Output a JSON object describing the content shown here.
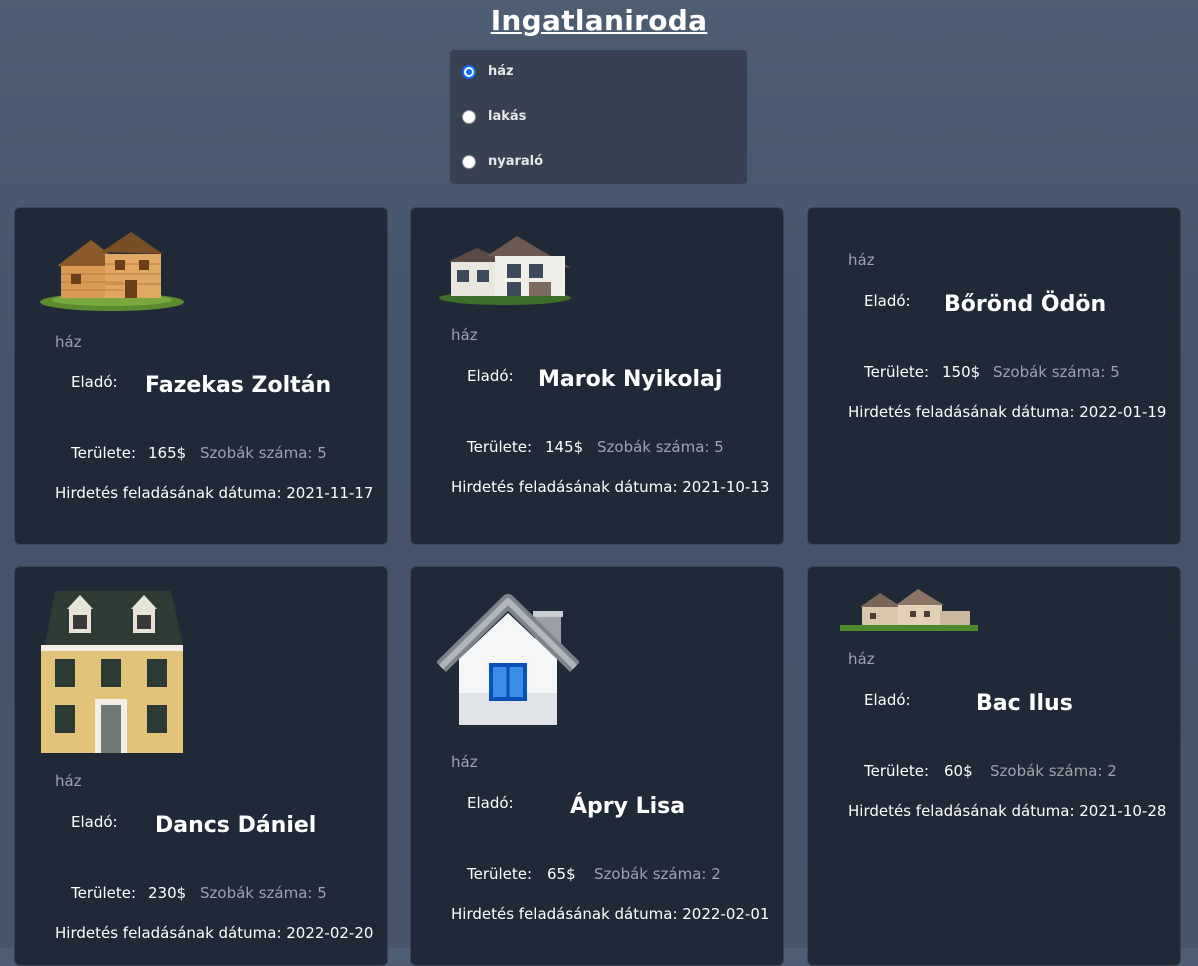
{
  "page": {
    "title": "Ingatlaniroda"
  },
  "filter": {
    "options": [
      {
        "label": "ház",
        "checked": true
      },
      {
        "label": "lakás",
        "checked": false
      },
      {
        "label": "nyaraló",
        "checked": false
      }
    ]
  },
  "labels": {
    "seller": "Eladó:",
    "area": "Területe:",
    "rooms_prefix": "Szobák száma:",
    "date_prefix": "Hirdetés feladásának dátuma:"
  },
  "listings": [
    {
      "type": "ház",
      "seller": "Fazekas Zoltán",
      "area": "165$",
      "rooms": "Szobák száma: 5",
      "date": "Hirdetés feladásának dátuma: 2021-11-17",
      "image": "log-cabin-house-image"
    },
    {
      "type": "ház",
      "seller": "Marok Nyikolaj",
      "area": "145$",
      "rooms": "Szobák száma: 5",
      "date": "Hirdetés feladásának dátuma: 2021-10-13",
      "image": "modern-house-image"
    },
    {
      "type": "ház",
      "seller": "Bőrönd Ödön",
      "area": "150$",
      "rooms": "Szobák száma: 5",
      "date": "Hirdetés feladásának dátuma: 2022-01-19",
      "image": null
    },
    {
      "type": "ház",
      "seller": "Dancs Dániel",
      "area": "230$",
      "rooms": "Szobák száma: 5",
      "date": "Hirdetés feladásának dátuma: 2022-02-20",
      "image": "dollhouse-image"
    },
    {
      "type": "ház",
      "seller": "Ápry Lisa",
      "area": "65$",
      "rooms": "Szobák száma: 2",
      "date": "Hirdetés feladásának dátuma: 2022-02-01",
      "image": "house-icon-image"
    },
    {
      "type": "ház",
      "seller": "Bac Ilus",
      "area": "60$",
      "rooms": "Szobák száma: 2",
      "date": "Hirdetés feladásának dátuma: 2021-10-28",
      "image": "villa-house-image"
    }
  ]
}
